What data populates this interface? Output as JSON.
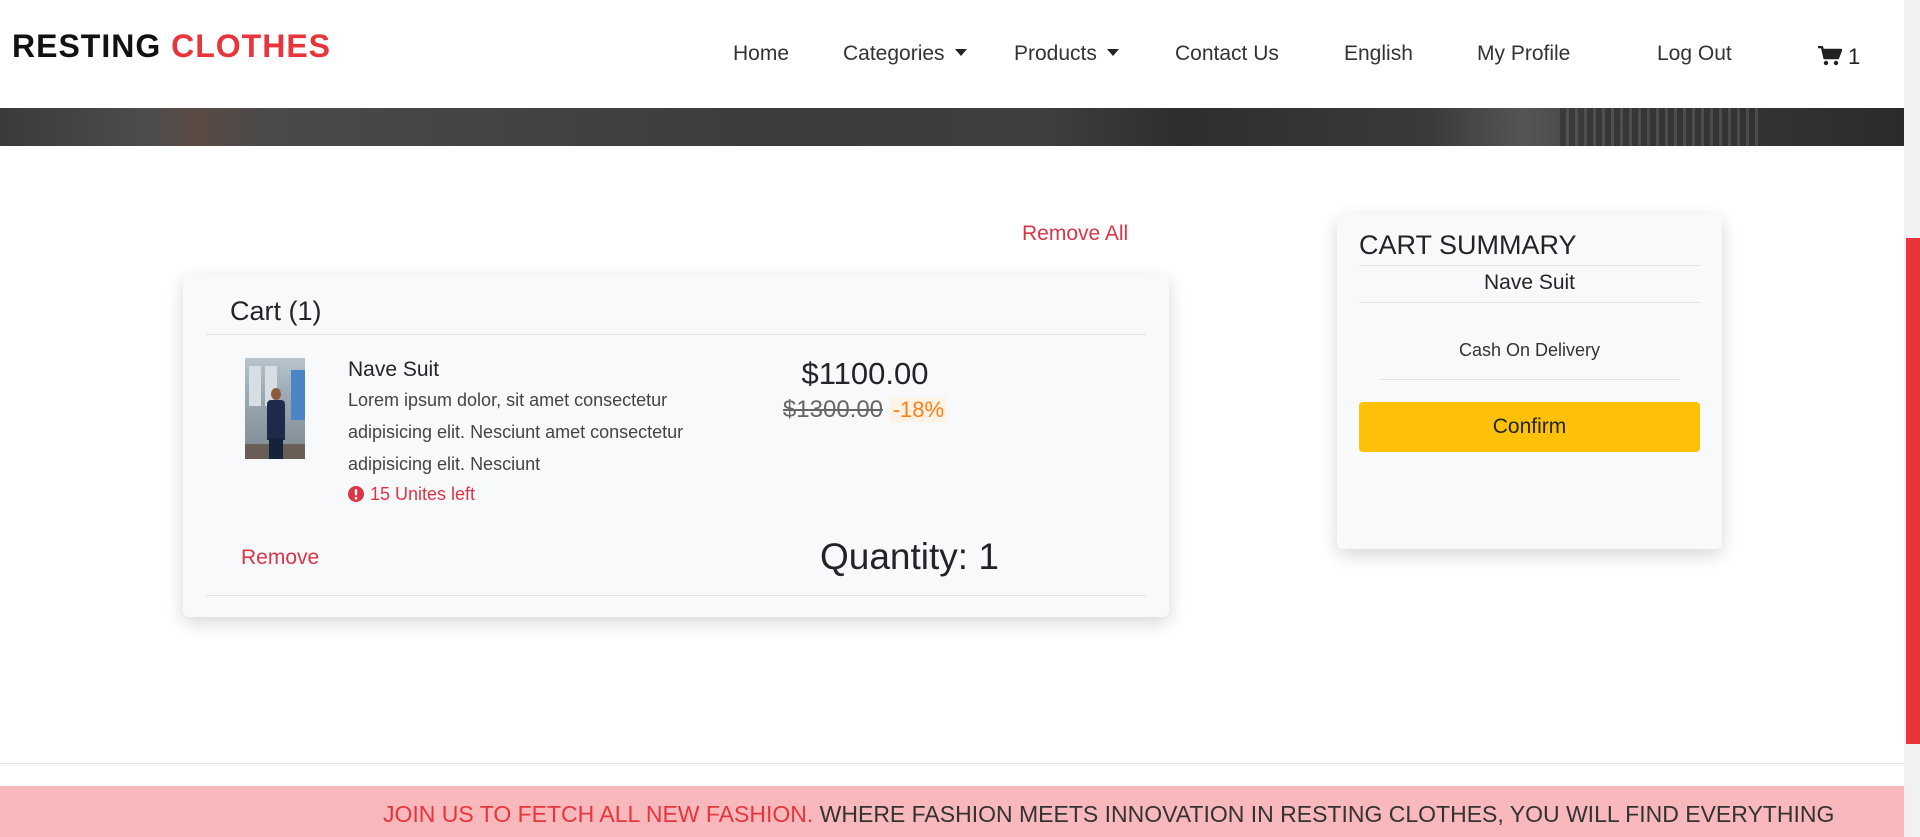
{
  "brand": {
    "part1": "RESTING",
    "part2": "CLOTHES"
  },
  "nav": {
    "home": "Home",
    "categories": "Categories",
    "products": "Products",
    "contact": "Contact Us",
    "language": "English",
    "profile": "My Profile",
    "logout": "Log Out",
    "cart_count": "1"
  },
  "cart": {
    "remove_all": "Remove All",
    "title": "Cart (1)",
    "item": {
      "name": "Nave Suit",
      "description": "Lorem ipsum dolor, sit amet consectetur adipisicing elit. Nesciunt amet consectetur adipisicing elit. Nesciunt",
      "stock": "15 Unites left",
      "price": "$1100.00",
      "old_price": "$1300.00",
      "discount": "-18%",
      "remove": "Remove",
      "quantity": "Quantity: 1"
    }
  },
  "summary": {
    "title": "CART SUMMARY",
    "item_name": "Nave Suit",
    "payment": "Cash On Delivery",
    "confirm": "Confirm"
  },
  "banner": {
    "highlight": "JOIN US TO FETCH ALL NEW FASHION.",
    "text": " WHERE FASHION MEETS INNOVATION IN RESTING CLOTHES, YOU WILL FIND EVERYTHING"
  },
  "colors": {
    "brand_red": "#e8353b",
    "danger": "#dc3545",
    "confirm_yellow": "#ffc107",
    "discount_orange": "#fd7e14",
    "banner_pink": "#f9b8bb"
  },
  "icons": {
    "cart": "shopping-cart-icon",
    "stock": "exclamation-circle-icon",
    "dropdown": "caret-down-icon"
  }
}
